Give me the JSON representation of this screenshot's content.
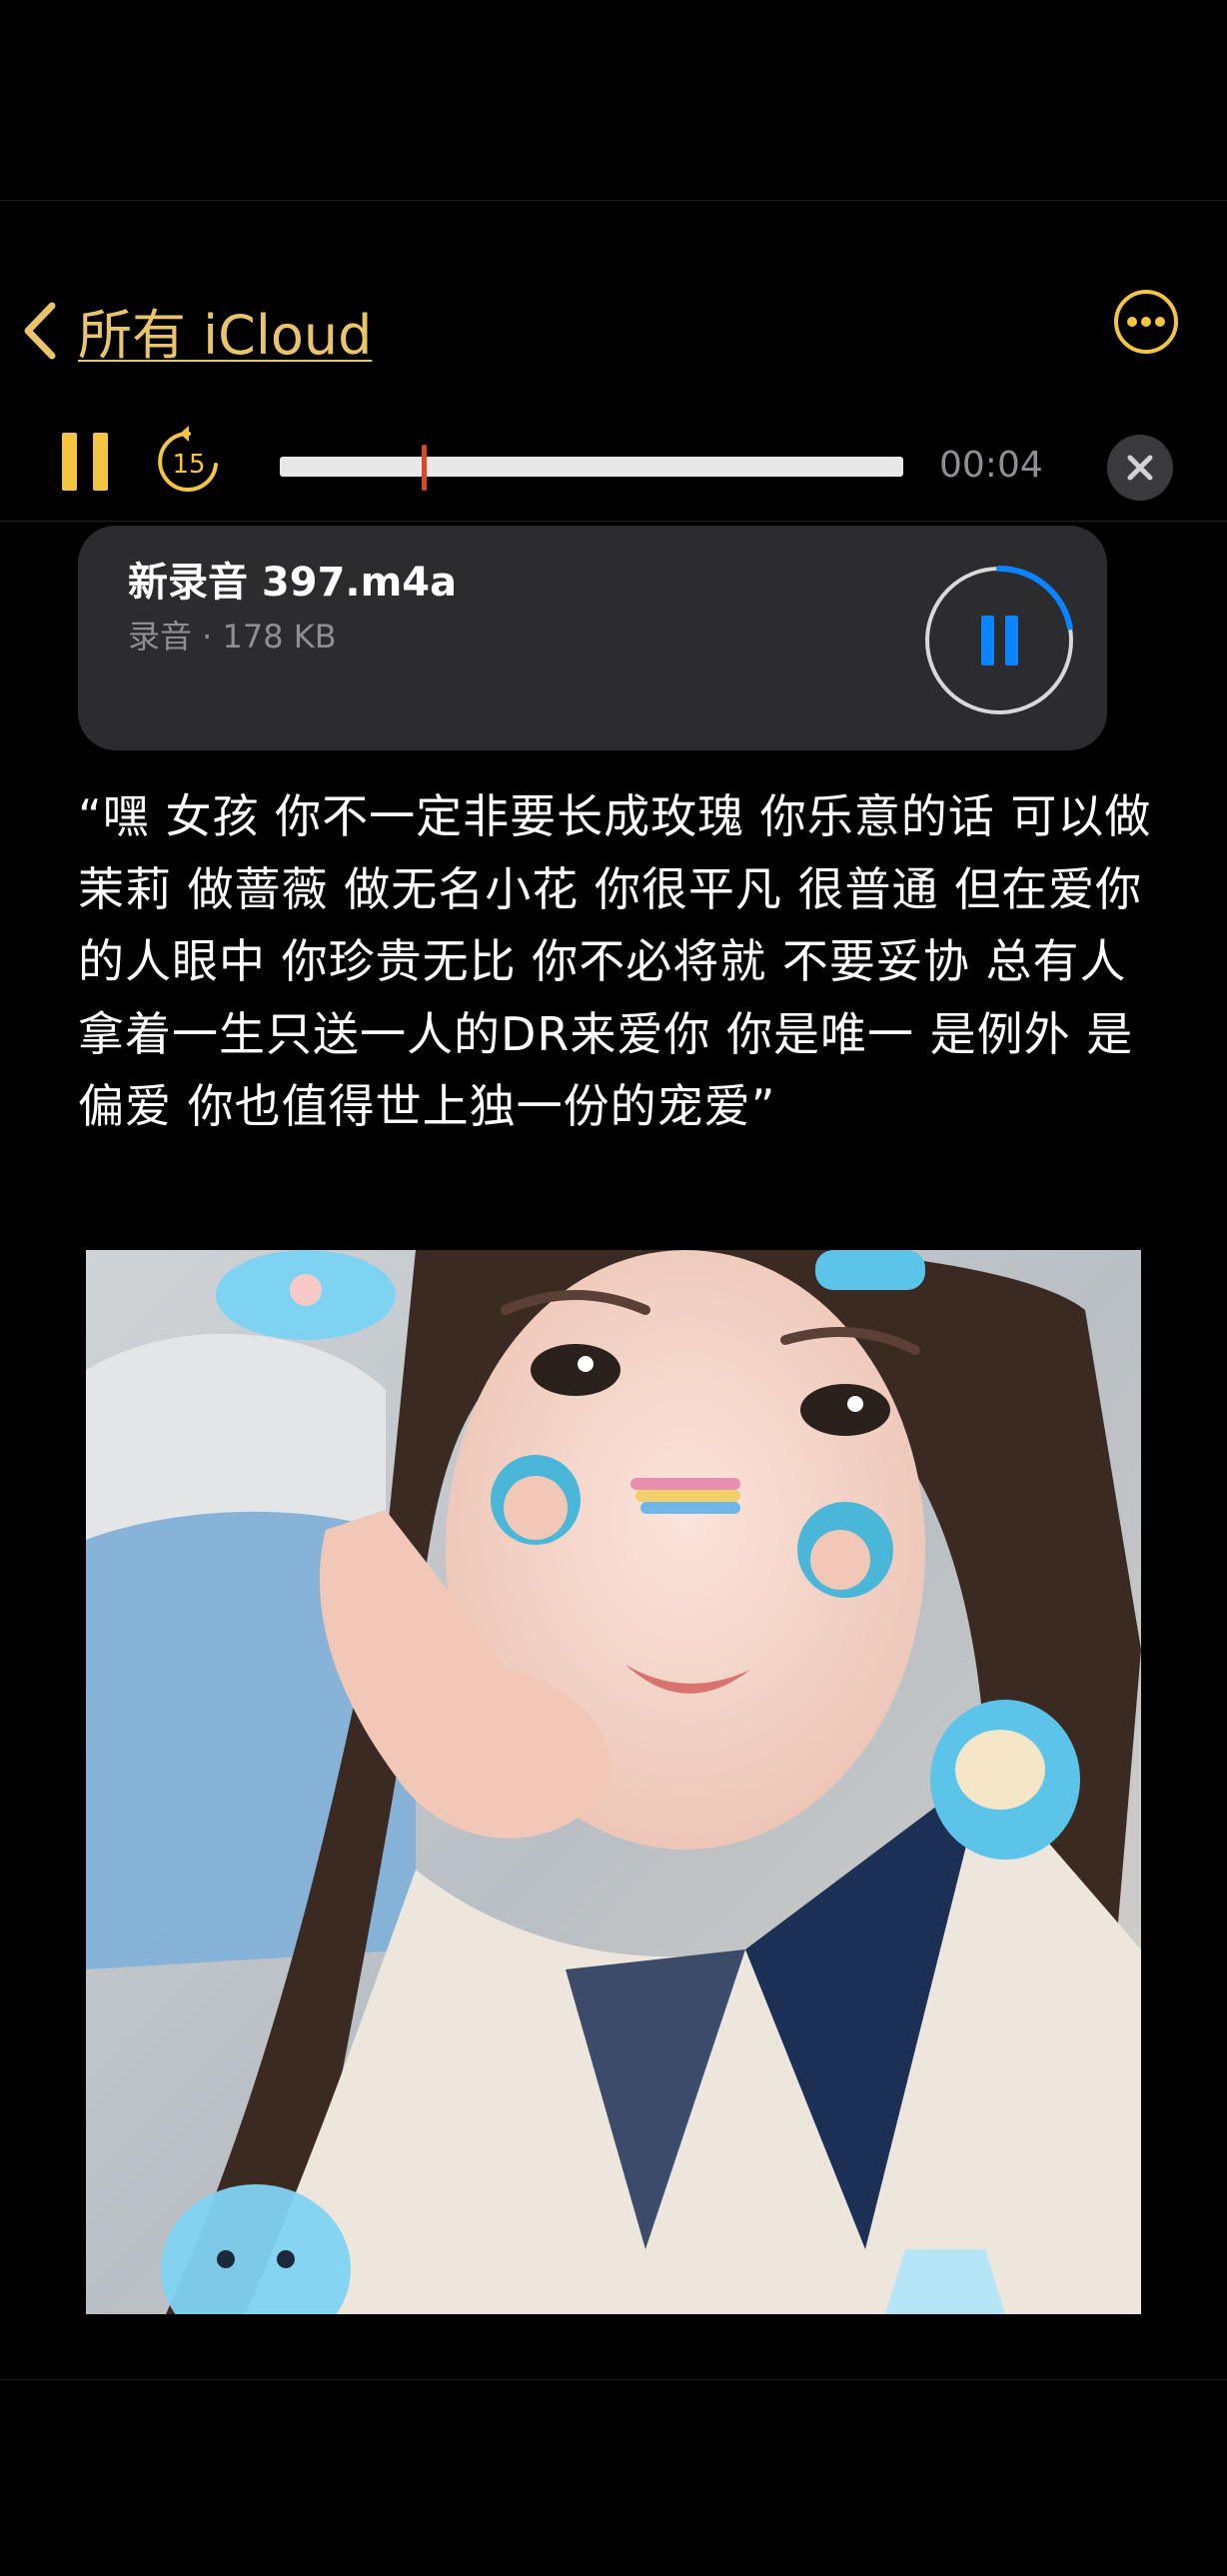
{
  "nav": {
    "back_label": "所有 iCloud"
  },
  "player": {
    "skip_seconds": "15",
    "elapsed": "00:04",
    "progress": 0.23
  },
  "recording": {
    "title": "新录音 397.m4a",
    "subtitle": "录音 · 178 KB",
    "load_progress": 0.22
  },
  "quote": {
    "text": "“嘿 女孩 你不一定非要长成玫瑰 你乐意的话 可以做茉莉 做蔷薇 做无名小花 你很平凡 很普通 但在爱你的人眼中 你珍贵无比 你不必将就 不要妥协 总有人拿着一生只送一人的DR来爱你 你是唯一 是例外 是偏爱 你也值得世上独一份的宠爱”"
  },
  "colors": {
    "accent": "#f4c542",
    "playhead": "#d9482b",
    "card_bg": "#2c2c2e",
    "play_icon": "#0a84ff"
  }
}
